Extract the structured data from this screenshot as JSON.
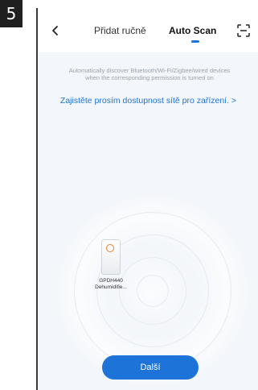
{
  "step_badge": "5",
  "header": {
    "tabs": [
      {
        "label": "Přidat ručně"
      },
      {
        "label": "Auto Scan"
      }
    ],
    "active_tab": "Auto Scan"
  },
  "scan": {
    "hint_line1": "Automatically discover Bluetooth/Wi-Fi/Zigbee/wired devices",
    "hint_line2": "when the corresponding permission is turned on",
    "network_link": "Zajistěte prosím dostupnost sítě pro zařízení. >"
  },
  "devices": [
    {
      "name_line1": "GPDH440",
      "name_line2": "Dehumidifie..."
    }
  ],
  "actions": {
    "next_label": "Další"
  },
  "colors": {
    "accent": "#1e73d8",
    "background": "#f3f6fa",
    "device_led": "#e77f2f"
  },
  "icons": {
    "back": "chevron-left-icon",
    "scan": "scan-frame-icon"
  }
}
